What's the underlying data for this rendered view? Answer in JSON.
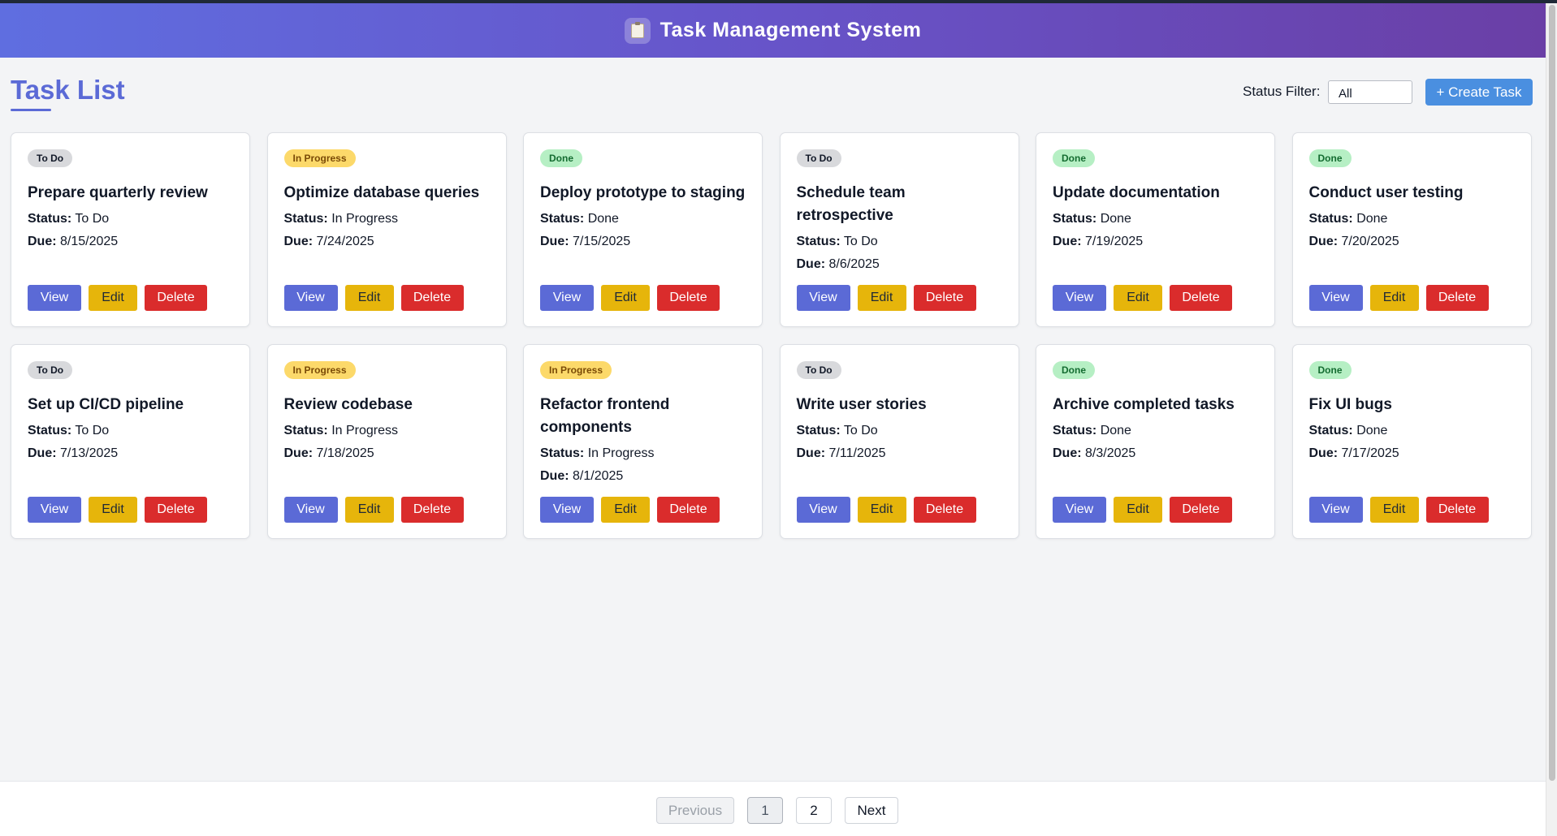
{
  "header": {
    "title": "Task Management System",
    "icon": "clipboard-icon"
  },
  "main": {
    "page_title": "Task List",
    "filter_label": "Status Filter:",
    "filter_value": "All",
    "create_label": "+ Create Task"
  },
  "labels": {
    "status": "Status:",
    "due": "Due:",
    "view": "View",
    "edit": "Edit",
    "delete": "Delete"
  },
  "status_colors": {
    "To Do": "#d8d9dc",
    "In Progress": "#fcd96a",
    "Done": "#b6efc4"
  },
  "tasks": [
    {
      "title": "Prepare quarterly review",
      "status": "To Do",
      "due": "8/15/2025"
    },
    {
      "title": "Optimize database queries",
      "status": "In Progress",
      "due": "7/24/2025"
    },
    {
      "title": "Deploy prototype to staging",
      "status": "Done",
      "due": "7/15/2025"
    },
    {
      "title": "Schedule team retrospective",
      "status": "To Do",
      "due": "8/6/2025"
    },
    {
      "title": "Update documentation",
      "status": "Done",
      "due": "7/19/2025"
    },
    {
      "title": "Conduct user testing",
      "status": "Done",
      "due": "7/20/2025"
    },
    {
      "title": "Set up CI/CD pipeline",
      "status": "To Do",
      "due": "7/13/2025"
    },
    {
      "title": "Review codebase",
      "status": "In Progress",
      "due": "7/18/2025"
    },
    {
      "title": "Refactor frontend components",
      "status": "In Progress",
      "due": "8/1/2025"
    },
    {
      "title": "Write user stories",
      "status": "To Do",
      "due": "7/11/2025"
    },
    {
      "title": "Archive completed tasks",
      "status": "Done",
      "due": "8/3/2025"
    },
    {
      "title": "Fix UI bugs",
      "status": "Done",
      "due": "7/17/2025"
    }
  ],
  "pagination": {
    "previous": "Previous",
    "pages": [
      "1",
      "2"
    ],
    "current": "1",
    "next": "Next"
  }
}
